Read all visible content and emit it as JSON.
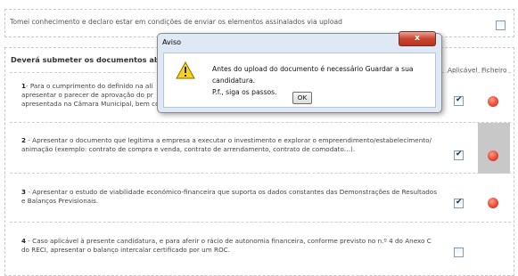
{
  "declaration": {
    "text": "Tomei conhecimento e declaro estar em condições de enviar os elementos assinalados via upload",
    "checked": false
  },
  "documents": {
    "title": "Deverá submeter os documentos abaixo",
    "col_aplicavel": "Aplicável",
    "col_ficheiro": "Ficheiro",
    "rows": [
      {
        "number": "1",
        "text": " - Para o cumprimento do definido na alínea ... apresentar o parecer de aprovação do pr... apresentada na Câmara Municipal, bem co...",
        "line1": "- Para o cumprimento do definido na alí",
        "line2": "apresentar o parecer de aprovação do pr",
        "line3": "apresentada na Câmara Municipal, bem co",
        "applicable": true,
        "file_status": "missing"
      },
      {
        "number": "2",
        "line1": " - Apresentar o documento que legitima a empresa a executar o investimento e explorar o empreendimento/estabelecimento/",
        "line2": "animação (exemplo: contrato de compra e venda, contrato de arrendamento, contrato de comodato…).",
        "applicable": true,
        "file_status": "missing"
      },
      {
        "number": "3",
        "line1": " - Apresentar o estudo de viabilidade económico-financeira que suporta os dados constantes das Demonstrações de Resultados",
        "line2": "e Balanços Previsionais.",
        "applicable": true,
        "file_status": "missing"
      },
      {
        "number": "4",
        "line1": " - Caso aplicável à presente candidatura, e para aferir o rácio de autonomia financeira, conforme previsto no n.º 4 do Anexo C",
        "line2": "do RECI, apresentar o balanço intercalar certificado por um ROC.",
        "applicable": false,
        "file_status": "none"
      }
    ]
  },
  "dialog": {
    "title": "Aviso",
    "close_label": "x",
    "message_line1": "Antes do upload do documento é necessário Guardar a sua candidatura.",
    "message_line2": "P.f., siga os passos.",
    "ok_label": "OK",
    "icon": "warning-icon"
  },
  "colors": {
    "status_missing": "#e8452e",
    "highlight_cell": "#c8c8c8",
    "dialog_frame": "#dfe9f5",
    "close_button": "#c9452f"
  }
}
